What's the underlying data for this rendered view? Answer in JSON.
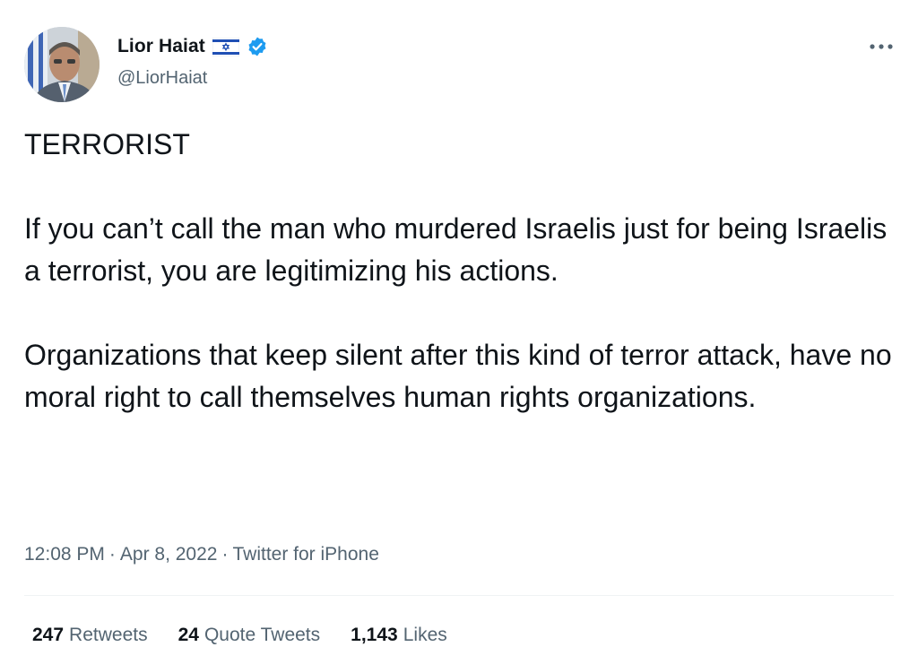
{
  "author": {
    "name": "Lior Haiat",
    "handle": "@LiorHaiat",
    "flag_icon": "israel-flag-icon",
    "verified_icon": "verified-badge-icon",
    "verified_color": "#1d9bf0"
  },
  "more_icon": "more-options-icon",
  "tweet": {
    "paragraphs": [
      "TERRORIST",
      "If you can’t call the man who murdered Israelis just for being Israelis a terrorist, you are legitimizing his actions.",
      "Organizations that keep silent after this kind of terror attack, have no moral right to call themselves human rights organizations."
    ]
  },
  "meta": {
    "time": "12:08 PM",
    "date": "Apr 8, 2022",
    "separator": "·",
    "source": "Twitter for iPhone"
  },
  "stats": {
    "retweets_count": "247",
    "retweets_label": "Retweets",
    "quotes_count": "24",
    "quotes_label": "Quote Tweets",
    "likes_count": "1,143",
    "likes_label": "Likes"
  },
  "colors": {
    "text_primary": "#0f1419",
    "text_secondary": "#536471",
    "divider": "#eff3f4",
    "accent": "#1d9bf0"
  }
}
